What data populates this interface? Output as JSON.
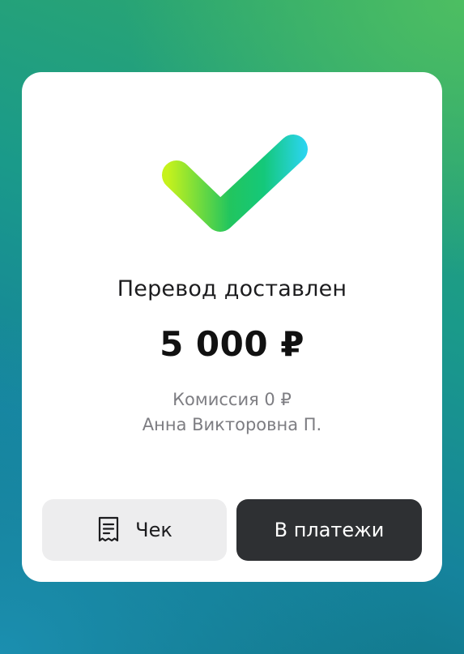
{
  "status": {
    "title": "Перевод доставлен",
    "amount": "5 000 ₽"
  },
  "details": {
    "commission": "Комиссия 0 ₽",
    "recipient": "Анна Викторовна П."
  },
  "buttons": {
    "receipt_label": "Чек",
    "payments_label": "В платежи"
  },
  "icons": {
    "success": "checkmark-icon",
    "receipt": "receipt-icon"
  },
  "colors": {
    "check_start": "#c6f21c",
    "check_mid": "#22c55e",
    "check_end": "#2bd4ee",
    "primary_button": "#2e3033",
    "secondary_button": "#ededee"
  }
}
